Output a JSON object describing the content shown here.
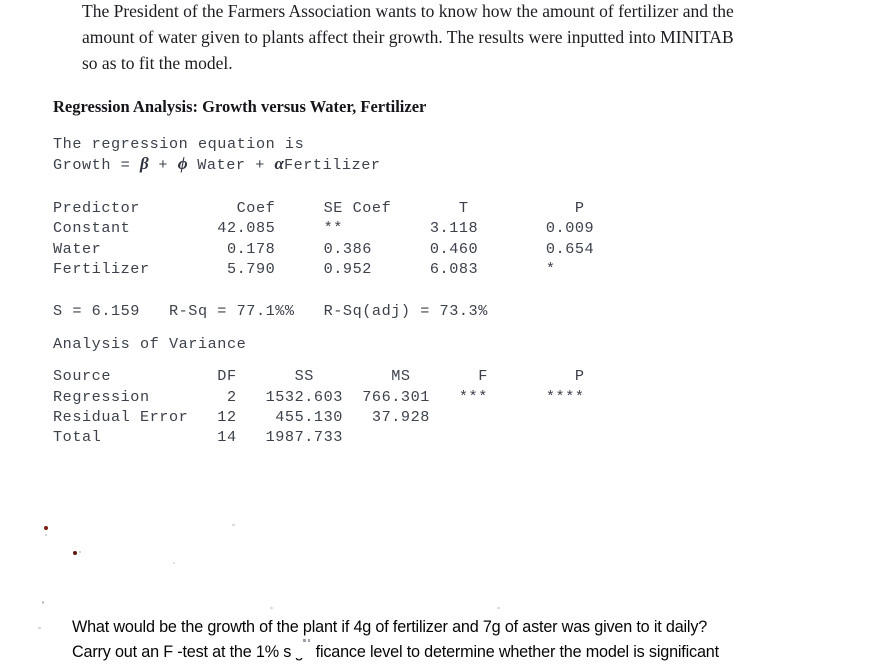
{
  "document": {
    "intro_paragraph": [
      "The President of the Farmers Association wants to know how the amount of fertilizer and the",
      "amount of water given to plants affect their growth. The results were inputted into MINITAB",
      "so as to fit the model."
    ]
  },
  "report": {
    "heading": "Regression Analysis: Growth versus Water, Fertilizer",
    "equation_intro": "The regression equation is",
    "equation": {
      "prefix": "Growth = ",
      "beta": "β",
      "plus_1": " + ",
      "phi": "ϕ",
      "water": " Water + ",
      "alpha": "α",
      "fertilizer": "Fertilizer"
    },
    "predictor_table": {
      "headers": [
        "Predictor",
        "Coef",
        "SE Coef",
        "T",
        "P"
      ],
      "rows": [
        {
          "predictor": "Constant",
          "coef": "42.085",
          "se_coef": "**",
          "t": "3.118",
          "p": "0.009"
        },
        {
          "predictor": "Water",
          "coef": "0.178",
          "se_coef": "0.386",
          "t": "0.460",
          "p": "0.654"
        },
        {
          "predictor": "Fertilizer",
          "coef": "5.790",
          "se_coef": "0.952",
          "t": "6.083",
          "p": "*"
        }
      ]
    },
    "summary": {
      "s_label": "S = ",
      "s_value": "6.159",
      "rsq_label": "R-Sq = ",
      "rsq_value": "77.1%%",
      "rsq_adj_label": "R-Sq(adj) = ",
      "rsq_adj_value": "73.3%"
    },
    "anova": {
      "title": "Analysis of Variance",
      "headers": [
        "Source",
        "DF",
        "SS",
        "MS",
        "F",
        "P"
      ],
      "rows": [
        {
          "source": "Regression",
          "df": "2",
          "ss": "1532.603",
          "ms": "766.301",
          "f": "***",
          "p": "****"
        },
        {
          "source": "Residual Error",
          "df": "12",
          "ss": "455.130",
          "ms": "37.928",
          "f": "",
          "p": ""
        },
        {
          "source": "Total",
          "df": "14",
          "ss": "1987.733",
          "ms": "",
          "f": "",
          "p": ""
        }
      ]
    }
  },
  "questions": {
    "line_1": "What would be the growth of the plant if 4g of fertilizer and 7g of aster was given to it daily?",
    "line_2": "Carry out an F -test at the 1% significance level to determine whether the model is significant"
  },
  "lines": {
    "summary_line": "S = 6.159   R-Sq = 77.1%%   R-Sq(adj) = 73.3%",
    "predictor_header": "Predictor          Coef     SE Coef       T           P",
    "predictor_row_1": "Constant         42.085     **         3.118       0.009",
    "predictor_row_2": "Water             0.178     0.386      0.460       0.654",
    "predictor_row_3": "Fertilizer        5.790     0.952      6.083       *",
    "anova_header": "Source           DF      SS        MS       F         P",
    "anova_row_1": "Regression        2   1532.603  766.301   ***      ****",
    "anova_row_2": "Residual Error   12    455.130   37.928",
    "anova_row_3": "Total            14   1987.733"
  }
}
